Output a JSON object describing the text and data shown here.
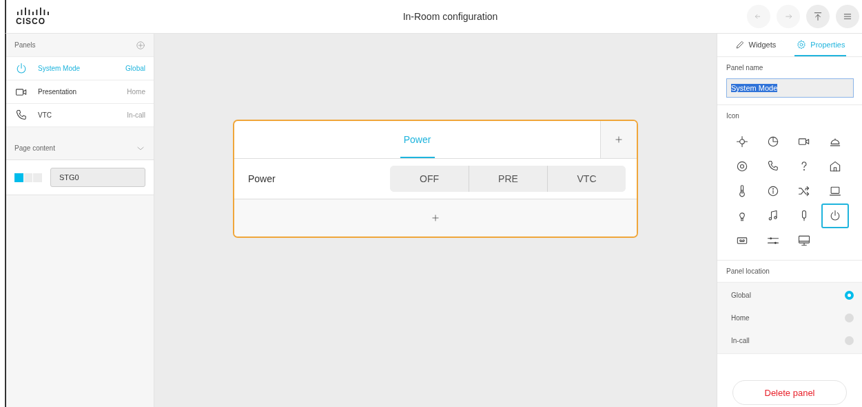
{
  "header": {
    "logo": "CISCO",
    "title": "In-Room configuration",
    "buttons": [
      {
        "kind": "undo",
        "disabled": true
      },
      {
        "kind": "redo",
        "disabled": true
      },
      {
        "kind": "upload",
        "disabled": false
      },
      {
        "kind": "menu",
        "disabled": false
      }
    ]
  },
  "sidebar": {
    "panels_heading": "Panels",
    "panels": [
      {
        "kind": "power",
        "name": "System Mode",
        "location": "Global",
        "selected": true
      },
      {
        "kind": "camera",
        "name": "Presentation",
        "location": "Home",
        "selected": false
      },
      {
        "kind": "phone",
        "name": "VTC",
        "location": "In-call",
        "selected": false
      }
    ],
    "page_content_heading": "Page content",
    "page": {
      "name": "STG0",
      "level": 0.33
    }
  },
  "canvas": {
    "tab": "Power",
    "rows": [
      {
        "label": "Power",
        "options": [
          "OFF",
          "PRE",
          "VTC"
        ]
      }
    ]
  },
  "properties": {
    "tabs": [
      {
        "label": "Widgets",
        "kind": "pencil",
        "selected": false
      },
      {
        "label": "Properties",
        "kind": "gear",
        "selected": true
      }
    ],
    "panel_name_label": "Panel name",
    "panel_name": "System Mode",
    "icon_label": "Icon",
    "icons": [
      {
        "kind": "brightness",
        "selected": false
      },
      {
        "kind": "pie",
        "selected": false
      },
      {
        "kind": "camera",
        "selected": false
      },
      {
        "kind": "bell",
        "selected": false
      },
      {
        "kind": "target",
        "selected": false
      },
      {
        "kind": "phone",
        "selected": false
      },
      {
        "kind": "question",
        "selected": false
      },
      {
        "kind": "home",
        "selected": false
      },
      {
        "kind": "thermometer",
        "selected": false
      },
      {
        "kind": "info",
        "selected": false
      },
      {
        "kind": "shuffle",
        "selected": false
      },
      {
        "kind": "laptop",
        "selected": false
      },
      {
        "kind": "bulb",
        "selected": false
      },
      {
        "kind": "music",
        "selected": false
      },
      {
        "kind": "mic",
        "selected": false
      },
      {
        "kind": "power",
        "selected": true
      },
      {
        "kind": "voicemail",
        "selected": false
      },
      {
        "kind": "sliders",
        "selected": false
      },
      {
        "kind": "monitor",
        "selected": false
      }
    ],
    "location_label": "Panel location",
    "locations": [
      {
        "label": "Global",
        "selected": true
      },
      {
        "label": "Home",
        "selected": false
      },
      {
        "label": "In-call",
        "selected": false
      }
    ],
    "delete": "Delete panel"
  }
}
